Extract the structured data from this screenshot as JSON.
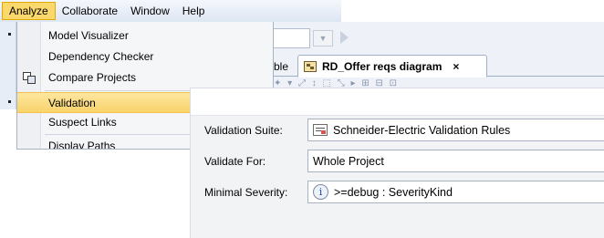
{
  "menubar": {
    "items": [
      "Analyze",
      "Collaborate",
      "Window",
      "Help"
    ]
  },
  "analyze_menu": {
    "items": [
      {
        "label": "Model Visualizer",
        "icon": null
      },
      {
        "label": "Dependency Checker",
        "icon": null
      },
      {
        "label": "Compare Projects",
        "icon": "compare-projects-icon"
      },
      {
        "label": "Validation",
        "icon": null,
        "highlighted": true
      },
      {
        "label": "Suspect Links",
        "icon": null
      },
      {
        "label": "Display Paths",
        "icon": null
      }
    ]
  },
  "diagram_tabs": {
    "previous_tab_fragment": "ble",
    "active_tab": {
      "label": "RD_Offer reqs diagram",
      "close": "×",
      "icon": "diagram-icon"
    }
  },
  "validation_dialog": {
    "fields": {
      "suite": {
        "label": "Validation Suite:",
        "value": "Schneider-Electric Validation Rules",
        "icon": "validation-suite-icon"
      },
      "validate_for": {
        "label": "Validate For:",
        "value": "Whole Project"
      },
      "severity": {
        "label": "Minimal Severity:",
        "value": ">=debug : SeverityKind",
        "icon": "info-icon",
        "icon_glyph": "i"
      }
    }
  },
  "colors": {
    "menu_highlight": "#f9d36b",
    "menubar_active": "#fbd86b",
    "dialog_body": "#f2f3f5"
  }
}
